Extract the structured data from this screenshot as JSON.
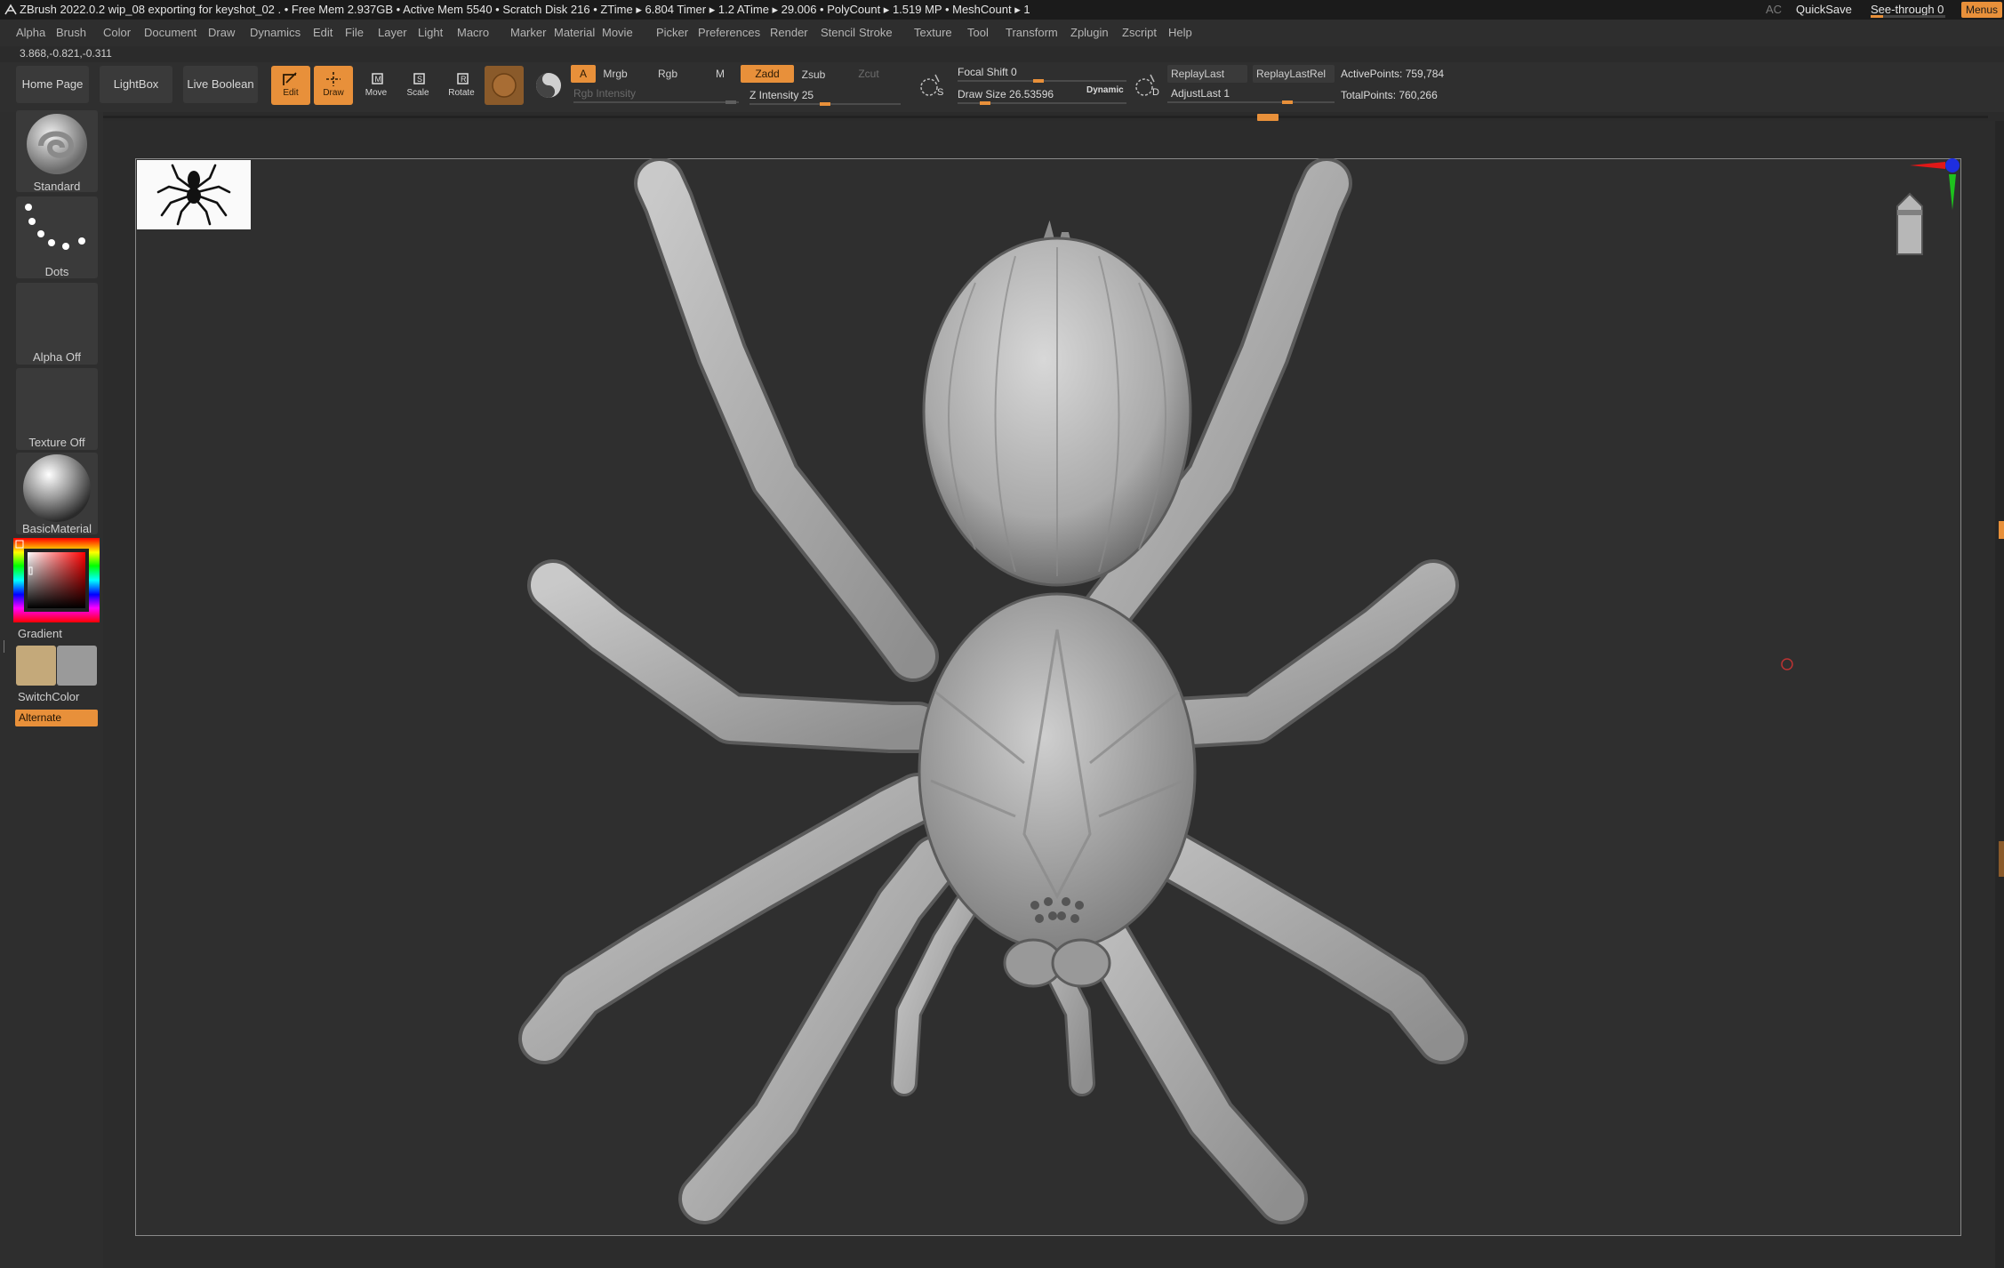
{
  "title_bar": {
    "text": "ZBrush 2022.0.2   wip_08 exporting for keyshot_02   . • Free Mem 2.937GB • Active Mem 5540 • Scratch Disk 216 •  ZTime ▸ 6.804 Timer ▸ 1.2 ATime ▸ 29.006 • PolyCount ▸ 1.519 MP   • MeshCount ▸ 1",
    "ac_label": "AC",
    "quicksave_label": "QuickSave",
    "seethrough_label": "See-through   0",
    "menus_label": "Menus"
  },
  "menubar": {
    "items": [
      "Alpha",
      "Brush",
      "Color",
      "Document",
      "Draw",
      "Dynamics",
      "Edit",
      "File",
      "Layer",
      "Light",
      "Macro",
      "Marker",
      "Material",
      "Movie",
      "Picker",
      "Preferences",
      "Render",
      "Stencil",
      "Stroke",
      "Texture",
      "Tool",
      "Transform",
      "Zplugin",
      "Zscript",
      "Help"
    ]
  },
  "coordinates": "3.868,-0.821,-0.311",
  "toolbar": {
    "home_page": "Home Page",
    "lightbox": "LightBox",
    "live_boolean": "Live Boolean",
    "edit": "Edit",
    "draw": "Draw",
    "move": "Move",
    "scale": "Scale",
    "rotate": "Rotate",
    "a_label": "A",
    "mrgb": "Mrgb",
    "rgb": "Rgb",
    "m": "M",
    "zadd": "Zadd",
    "zsub": "Zsub",
    "zcut": "Zcut",
    "rgb_intensity": "Rgb Intensity",
    "z_intensity": "Z Intensity 25",
    "focal_shift": "Focal Shift 0",
    "draw_size": "Draw Size 26.53596",
    "dynamic": "Dynamic",
    "replay_last": "ReplayLast",
    "replay_last_rel": "ReplayLastRel",
    "adjust_last": "AdjustLast 1",
    "active_points": "ActivePoints: 759,784",
    "total_points": "TotalPoints: 760,266",
    "s_label": "S",
    "d_label": "D"
  },
  "left_tray": {
    "brush": "Standard",
    "stroke": "Dots",
    "alpha": "Alpha Off",
    "texture": "Texture Off",
    "material": "BasicMaterial",
    "gradient": "Gradient",
    "switch_color": "SwitchColor",
    "alternate": "Alternate"
  },
  "colors": {
    "accent": "#e8903a",
    "main_color": "#c4a97a",
    "secondary_color": "#9a9a9a"
  }
}
